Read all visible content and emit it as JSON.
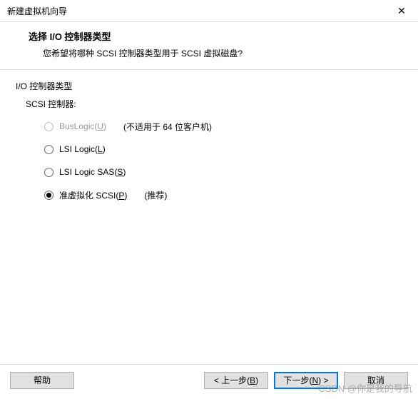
{
  "window": {
    "title": "新建虚拟机向导"
  },
  "header": {
    "title": "选择 I/O 控制器类型",
    "subtitle": "您希望将哪种 SCSI 控制器类型用于 SCSI 虚拟磁盘?"
  },
  "group": {
    "title": "I/O 控制器类型",
    "subtitle": "SCSI 控制器:"
  },
  "options": {
    "buslogic": {
      "label_pre": "BusLogic(",
      "hotkey": "U",
      "label_post": ")",
      "note": "(不适用于 64 位客户机)",
      "disabled": true,
      "selected": false
    },
    "lsilogic": {
      "label_pre": "LSI Logic(",
      "hotkey": "L",
      "label_post": ")",
      "disabled": false,
      "selected": false
    },
    "lsisas": {
      "label_pre": "LSI Logic SAS(",
      "hotkey": "S",
      "label_post": ")",
      "disabled": false,
      "selected": false
    },
    "pvscsi": {
      "label_pre": "准虚拟化 SCSI(",
      "hotkey": "P",
      "label_post": ")",
      "note": "(推荐)",
      "disabled": false,
      "selected": true
    }
  },
  "buttons": {
    "help": "帮助",
    "back_pre": "< 上一步(",
    "back_hot": "B",
    "back_post": ")",
    "next_pre": "下一步(",
    "next_hot": "N",
    "next_post": ") >",
    "cancel": "取消"
  },
  "watermark": "CSDN @你是我的导航"
}
